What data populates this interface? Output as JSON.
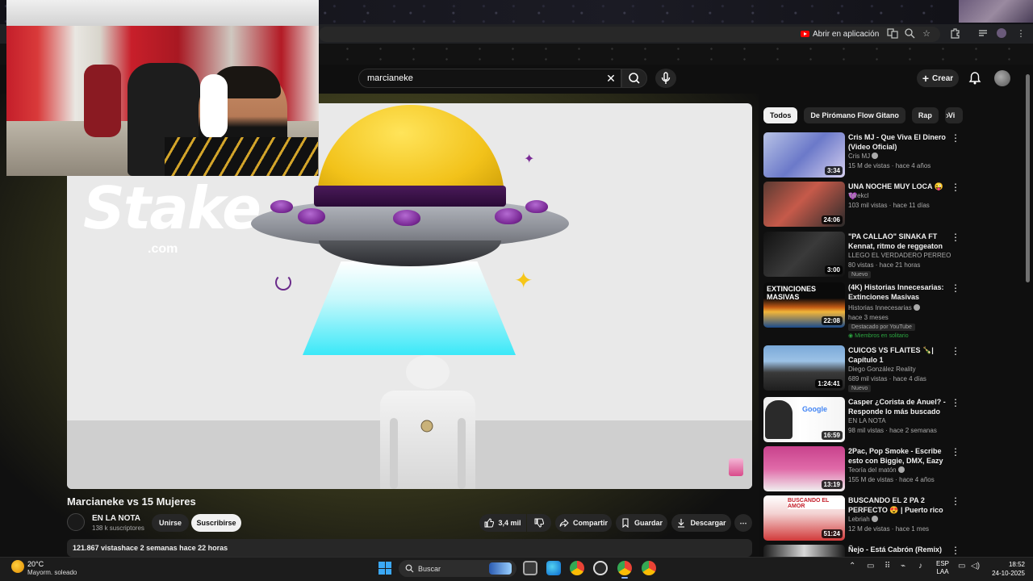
{
  "browser": {
    "open_in_app_label": "Abrir en aplicación"
  },
  "header": {
    "search_value": "marcianeke",
    "create_label": "Crear"
  },
  "video": {
    "title": "Marcianeke vs 15 Mujeres",
    "overlay_brand": "Stake",
    "overlay_brand_suffix": ".com"
  },
  "channel": {
    "name": "EN LA NOTA",
    "subscribers": "138 k suscriptores",
    "join_label": "Unirse",
    "subscribe_label": "Suscribirse"
  },
  "actions": {
    "likes": "3,4 mil",
    "share_label": "Compartir",
    "save_label": "Guardar",
    "download_label": "Descargar"
  },
  "description": {
    "summary": "121.867 vistashace 2 semanas  hace 22 horas"
  },
  "chips": [
    "Todos",
    "De Pirómano Flow Gitano",
    "Rap",
    "Vi"
  ],
  "recommendations": [
    {
      "title": "Cris MJ - Que Viva El Dinero (Video Oficial)",
      "channel": "Cris MJ",
      "verified": true,
      "meta": "15 M de vistas · hace 4 años",
      "duration": "3:34",
      "badge": "",
      "member": ""
    },
    {
      "title": "UNA NOCHE MUY LOCA 😜💜",
      "channel": "Tarekcl",
      "verified": false,
      "meta": "103 mil vistas · hace 11 días",
      "duration": "24:06",
      "badge": "",
      "member": ""
    },
    {
      "title": "\"PA CALLAO\" SINAKA FT Kennat, ritmo de reggeaton ...",
      "channel": "LLEGO EL VERDADERO PERREO",
      "verified": false,
      "meta": "80 vistas · hace 21 horas",
      "duration": "3:00",
      "badge": "Nuevo",
      "member": ""
    },
    {
      "title": "(4K) Historias Innecesarias: Extinciones Masivas",
      "channel": "Historias Innecesarias",
      "verified": true,
      "meta": "hace 3 meses",
      "duration": "22:08",
      "badge": "Destacado por YouTube",
      "member": "Miembros en solitario",
      "thumb_text": "EXTINCIONES MASIVAS"
    },
    {
      "title": "CUICOS VS FLAITES 🍾| Capítulo 1",
      "channel": "Diego González Reality",
      "verified": false,
      "meta": "689 mil vistas · hace 4 días",
      "duration": "1:24:41",
      "badge": "Nuevo",
      "member": ""
    },
    {
      "title": "Casper ¿Corista de Anuel? - Responde lo más buscado",
      "channel": "EN LA NOTA",
      "verified": false,
      "meta": "98 mil vistas · hace 2 semanas",
      "duration": "16:59",
      "badge": "",
      "member": "",
      "thumb_text": "Google"
    },
    {
      "title": "2Pac, Pop Smoke - Escribe esto con Biggie, DMX, Eazy E, Ice ...",
      "channel": "Teoría del matón",
      "verified": true,
      "meta": "155 M de vistas · hace 4 años",
      "duration": "13:19",
      "badge": "",
      "member": ""
    },
    {
      "title": "BUSCANDO EL 2 PA 2 PERFECTO 😍 | Puerto rico 🇵🇷",
      "channel": "Lebriah",
      "verified": true,
      "meta": "12 M de vistas · hace 1 mes",
      "duration": "51:24",
      "badge": "",
      "member": "",
      "thumb_text": "BUSCANDO EL AMOR"
    },
    {
      "title": "Ñejo - Está Cabrón (Remix)",
      "channel": "",
      "verified": false,
      "meta": "",
      "duration": "",
      "badge": "",
      "member": ""
    }
  ],
  "taskbar": {
    "temperature": "20°C",
    "weather_desc": "Mayorm. soleado",
    "search_label": "Buscar",
    "lang_line1": "ESP",
    "lang_line2": "LAA",
    "time": "18:52",
    "date": "24-10-2025"
  },
  "colors": {
    "accent_red": "#ff0000",
    "member_green": "#2ba640",
    "ufo_yellow": "#f2c21a",
    "ufo_purple": "#7a2a96",
    "beam_cyan": "#3ae8f8"
  }
}
